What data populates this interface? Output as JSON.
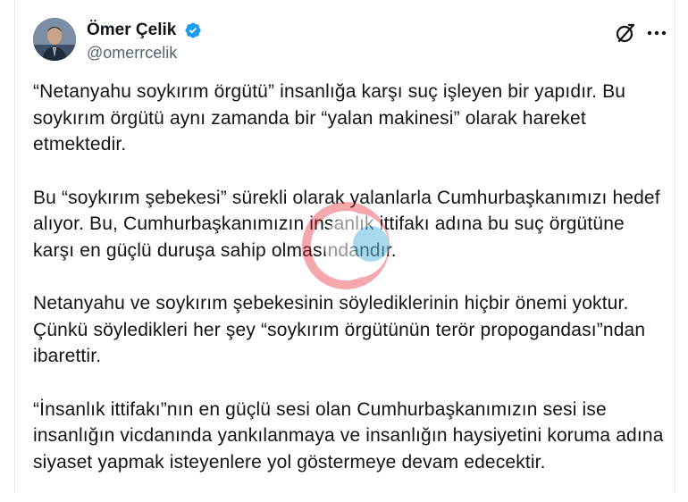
{
  "post": {
    "author": {
      "display_name": "Ömer Çelik",
      "handle": "@omerrcelik",
      "avatar_icon": "profile-photo",
      "verified_icon": "verified-badge-icon",
      "verified_color": "#1d9bf0"
    },
    "actions": {
      "grok_icon": "grok-icon",
      "more_icon": "more-options-icon"
    },
    "paragraphs": [
      "“Netanyahu soykırım örgütü” insanlığa karşı suç işleyen bir yapıdır. Bu soykırım örgütü aynı zamanda bir “yalan makinesi” olarak hareket etmektedir.",
      "Bu “soykırım şebekesi” sürekli olarak yalanlarla Cumhurbaşkanımızı hedef alıyor. Bu, Cumhurbaşkanımızın insanlık ittifakı adına bu suç örgütüne karşı en güçlü duruşa sahip olmasındandır.",
      "Netanyahu ve soykırım şebekesinin söylediklerinin hiçbir önemi yoktur. Çünkü söyledikleri her şey “soykırım örgütünün terör propogandası”ndan ibarettir.",
      "“İnsanlık ittifakı”nın en güçlü sesi olan Cumhurbaşkanımızın sesi ise insanlığın vicdanında yankılanmaya ve insanlığın haysiyetini koruma adına siyaset yapmak isteyenlere yol göstermeye devam edecektir."
    ]
  },
  "colors": {
    "text": "#0f1419",
    "secondary_text": "#536471",
    "verified": "#1d9bf0"
  }
}
